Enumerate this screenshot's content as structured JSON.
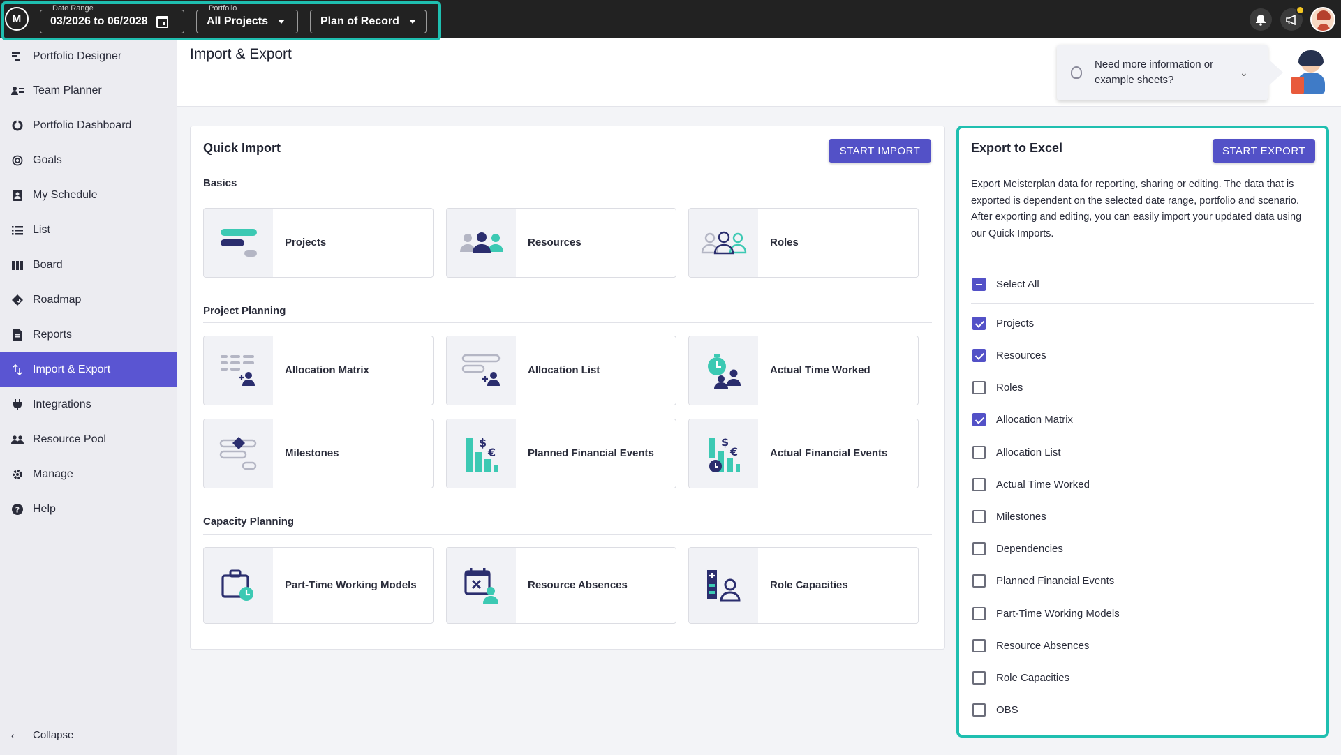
{
  "topbar": {
    "logo": "M",
    "date_range": {
      "label": "Date Range",
      "value": "03/2026 to 06/2028"
    },
    "portfolio": {
      "label": "Portfolio",
      "value": "All Projects"
    },
    "scenario": {
      "value": "Plan of Record"
    },
    "icons": [
      "bell-icon",
      "megaphone-icon",
      "user-avatar"
    ]
  },
  "sidebar": {
    "items": [
      {
        "label": "Portfolio Designer",
        "icon": "portfolio-designer-icon"
      },
      {
        "label": "Team Planner",
        "icon": "team-planner-icon"
      },
      {
        "label": "Portfolio Dashboard",
        "icon": "dashboard-icon"
      },
      {
        "label": "Goals",
        "icon": "goals-icon"
      },
      {
        "label": "My Schedule",
        "icon": "schedule-icon"
      },
      {
        "label": "List",
        "icon": "list-icon"
      },
      {
        "label": "Board",
        "icon": "board-icon"
      },
      {
        "label": "Roadmap",
        "icon": "roadmap-icon"
      },
      {
        "label": "Reports",
        "icon": "reports-icon"
      },
      {
        "label": "Import & Export",
        "icon": "import-export-icon",
        "active": true
      },
      {
        "label": "Integrations",
        "icon": "integrations-icon"
      },
      {
        "label": "Resource Pool",
        "icon": "resource-pool-icon"
      },
      {
        "label": "Manage",
        "icon": "gear-icon"
      },
      {
        "label": "Help",
        "icon": "help-icon"
      }
    ],
    "collapse": "Collapse"
  },
  "page": {
    "title": "Import & Export"
  },
  "help": {
    "text": "Need more information or example sheets?"
  },
  "quick_import": {
    "title": "Quick Import",
    "button": "START IMPORT",
    "sections": [
      {
        "label": "Basics",
        "tiles": [
          "Projects",
          "Resources",
          "Roles"
        ]
      },
      {
        "label": "Project Planning",
        "tiles": [
          "Allocation Matrix",
          "Allocation List",
          "Actual Time Worked",
          "Milestones",
          "Planned Financial Events",
          "Actual Financial Events"
        ]
      },
      {
        "label": "Capacity Planning",
        "tiles": [
          "Part-Time Working Models",
          "Resource Absences",
          "Role Capacities"
        ]
      }
    ]
  },
  "export": {
    "title": "Export to Excel",
    "button": "START EXPORT",
    "description_1": "Export Meisterplan data for reporting, sharing or editing. The data that is exported is dependent on the selected date range, portfolio and scenario.",
    "description_2": "After exporting and editing, you can easily import your updated data using our Quick Imports.",
    "select_all": "Select All",
    "options": [
      {
        "label": "Projects",
        "checked": true
      },
      {
        "label": "Resources",
        "checked": true
      },
      {
        "label": "Roles",
        "checked": false
      },
      {
        "label": "Allocation Matrix",
        "checked": true
      },
      {
        "label": "Allocation List",
        "checked": false
      },
      {
        "label": "Actual Time Worked",
        "checked": false
      },
      {
        "label": "Milestones",
        "checked": false
      },
      {
        "label": "Dependencies",
        "checked": false
      },
      {
        "label": "Planned Financial Events",
        "checked": false
      },
      {
        "label": "Part-Time Working Models",
        "checked": false
      },
      {
        "label": "Resource Absences",
        "checked": false
      },
      {
        "label": "Role Capacities",
        "checked": false
      },
      {
        "label": "OBS",
        "checked": false
      }
    ]
  },
  "colors": {
    "accent": "#5351c7",
    "teal": "#1fbfb0",
    "icon_teal": "#3cc9b3",
    "icon_navy": "#2b2e6e"
  }
}
